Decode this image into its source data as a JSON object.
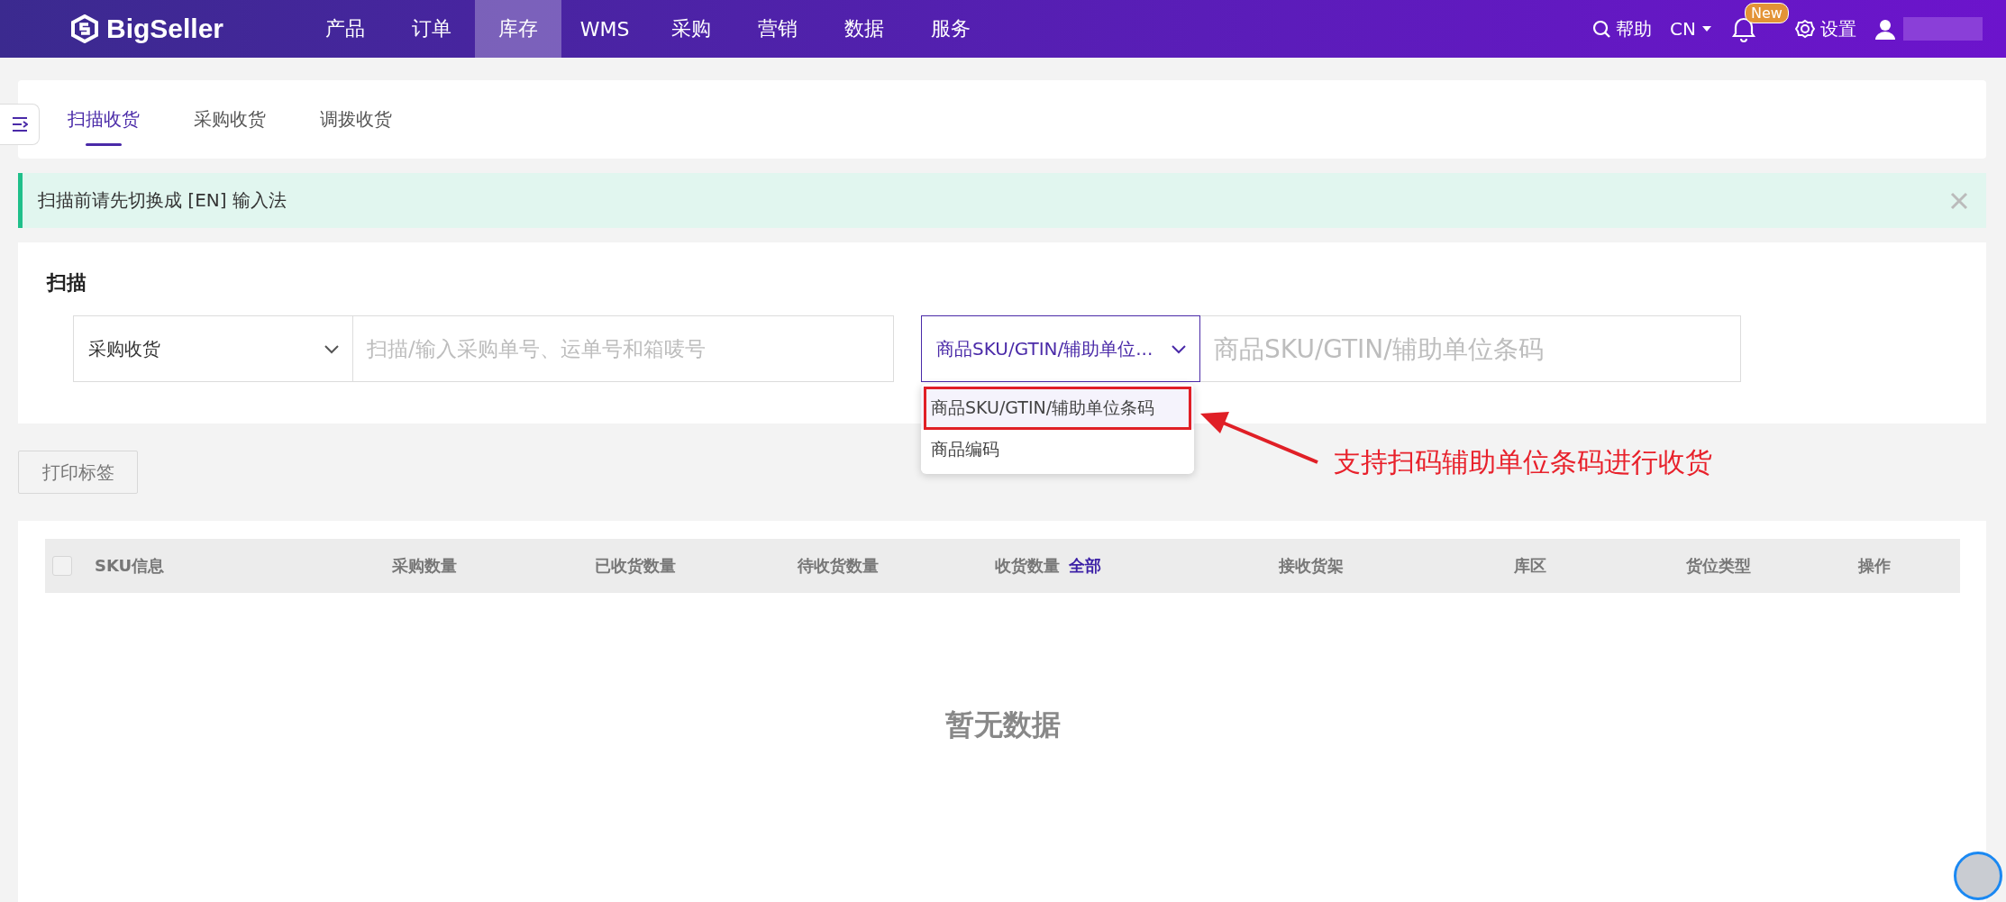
{
  "header": {
    "logo": "BigSeller",
    "nav": [
      {
        "label": "产品",
        "selected": false
      },
      {
        "label": "订单",
        "selected": false
      },
      {
        "label": "库存",
        "selected": true
      },
      {
        "label": "WMS",
        "selected": false
      },
      {
        "label": "采购",
        "selected": false
      },
      {
        "label": "营销",
        "selected": false
      },
      {
        "label": "数据",
        "selected": false
      },
      {
        "label": "服务",
        "selected": false
      }
    ],
    "help": "帮助",
    "language": "CN",
    "badge": "New",
    "settings": "设置"
  },
  "tabs": [
    {
      "label": "扫描收货",
      "selected": true
    },
    {
      "label": "采购收货",
      "selected": false
    },
    {
      "label": "调拨收货",
      "selected": false
    }
  ],
  "alert": {
    "text": "扫描前请先切换成 [EN] 输入法"
  },
  "scan": {
    "title": "扫描",
    "mode_select": {
      "value": "采购收货"
    },
    "order_input": {
      "placeholder": "扫描/输入采购单号、运单号和箱唛号"
    },
    "type_select": {
      "value": "商品SKU/GTIN/辅助单位...",
      "expanded": true,
      "options": [
        {
          "label": "商品SKU/GTIN/辅助单位条码",
          "selected": true
        },
        {
          "label": "商品编码",
          "selected": false
        }
      ]
    },
    "code_input": {
      "placeholder": "商品SKU/GTIN/辅助单位条码"
    }
  },
  "annotation": {
    "text": "支持扫码辅助单位条码进行收货"
  },
  "print_button": "打印标签",
  "table": {
    "checked": false,
    "columns": [
      {
        "label": "SKU信息"
      },
      {
        "label": "采购数量"
      },
      {
        "label": "已收货数量"
      },
      {
        "label": "待收货数量"
      },
      {
        "label": "收货数量",
        "action": "全部"
      },
      {
        "label": "接收货架"
      },
      {
        "label": "库区"
      },
      {
        "label": "货位类型"
      },
      {
        "label": "操作"
      }
    ],
    "empty_text": "暂无数据"
  }
}
